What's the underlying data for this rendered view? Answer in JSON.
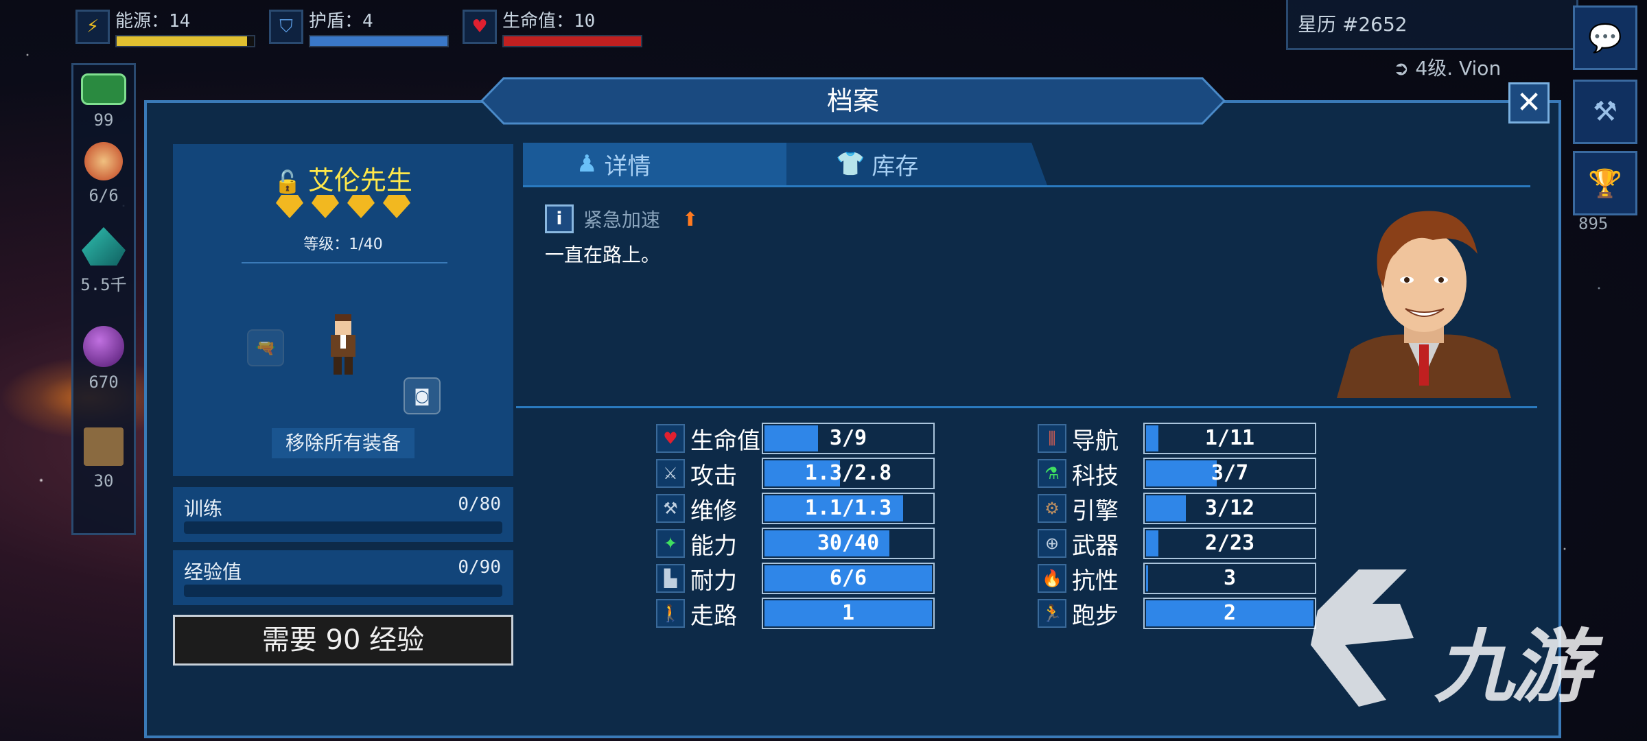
{
  "hud": {
    "energy": {
      "label": "能源：14",
      "fill": 0.95,
      "color": "#e0c030"
    },
    "shield": {
      "label": "护盾：4",
      "fill": 1.0,
      "color": "#3a78c8"
    },
    "health": {
      "label": "生命值：10",
      "fill": 1.0,
      "color": "#c02020"
    }
  },
  "top_right": {
    "calendar": "星历 #2652",
    "player_level": "4级. Vion",
    "trophy_count": "895"
  },
  "resources": [
    {
      "icon": "money-icon",
      "value": "99"
    },
    {
      "icon": "crew-icon",
      "value": "6/6"
    },
    {
      "icon": "mineral-icon",
      "value": "5.5千"
    },
    {
      "icon": "gas-icon",
      "value": "670"
    },
    {
      "icon": "crate-icon",
      "value": "30"
    }
  ],
  "panel": {
    "title": "档案"
  },
  "character": {
    "name": "艾伦先生",
    "stars": 4,
    "level": "等级：1/40",
    "remove_all": "移除所有装备"
  },
  "training": {
    "label": "训练",
    "value": "0/80"
  },
  "experience": {
    "label": "经验值",
    "value": "0/90"
  },
  "need_button": "需要 90 经验",
  "tabs": {
    "details": "详情",
    "inventory": "库存"
  },
  "skill": {
    "name": "紧急加速",
    "description": "一直在路上。"
  },
  "stats_left": [
    {
      "name": "生命值",
      "value": "3/9",
      "fill": 0.33,
      "icon": "heart-icon"
    },
    {
      "name": "攻击",
      "value": "1.3/2.8",
      "fill": 0.46,
      "icon": "sword-icon"
    },
    {
      "name": "维修",
      "value": "1.1/1.3",
      "fill": 0.83,
      "icon": "hammer-icon"
    },
    {
      "name": "能力",
      "value": "30/40",
      "fill": 0.75,
      "icon": "ability-icon"
    },
    {
      "name": "耐力",
      "value": "6/6",
      "fill": 1.0,
      "icon": "boot-icon"
    },
    {
      "name": "走路",
      "value": "1",
      "fill": 1.0,
      "icon": "walk-icon"
    }
  ],
  "stats_right": [
    {
      "name": "导航",
      "value": "1/11",
      "fill": 0.09,
      "icon": "navigation-icon"
    },
    {
      "name": "科技",
      "value": "3/7",
      "fill": 0.43,
      "icon": "flask-icon"
    },
    {
      "name": "引擎",
      "value": "3/12",
      "fill": 0.25,
      "icon": "engine-icon"
    },
    {
      "name": "武器",
      "value": "2/23",
      "fill": 0.09,
      "icon": "crosshair-icon"
    },
    {
      "name": "抗性",
      "value": "3",
      "fill": 0.03,
      "icon": "fire-icon"
    },
    {
      "name": "跑步",
      "value": "2",
      "fill": 1.0,
      "icon": "run-icon"
    }
  ],
  "watermark": "九游"
}
